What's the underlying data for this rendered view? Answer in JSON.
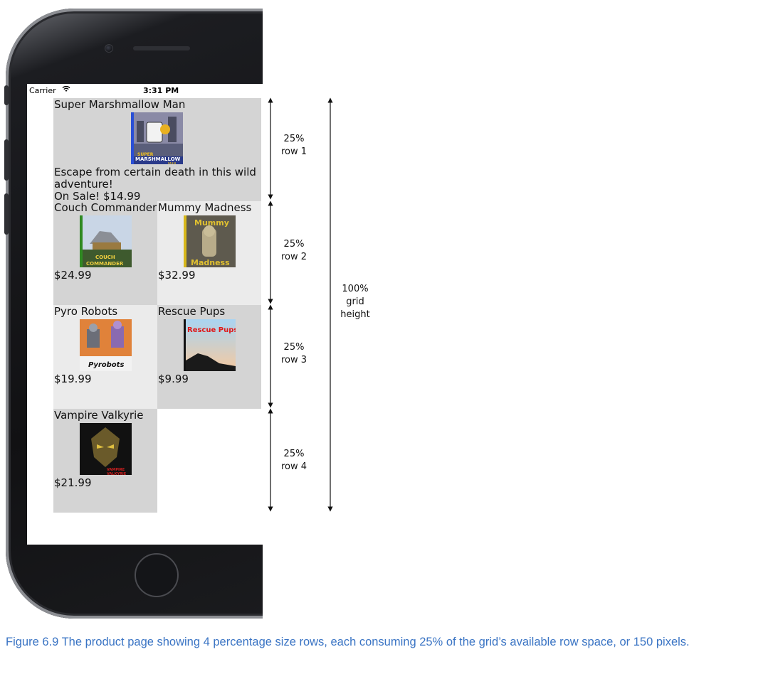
{
  "status_bar": {
    "carrier": "Carrier",
    "time": "3:31 PM"
  },
  "products": [
    {
      "title": "Super Marshmallow Man",
      "description": "Escape from certain death in this wild adventure!",
      "price": "On Sale! $14.99",
      "thumb_text_1": "SUPER",
      "thumb_text_2": "MARSHMALLOW",
      "thumb_text_3": "MAN",
      "accent": "#2a4fd6"
    },
    {
      "title": "Couch Commander",
      "price": "$24.99",
      "thumb_text_1": "COUCH",
      "thumb_text_2": "COMMANDER",
      "accent": "#2f8a22"
    },
    {
      "title": "Mummy Madness",
      "price": "$32.99",
      "thumb_text_1": "Mummy",
      "thumb_text_2": "Madness",
      "accent": "#d8b81a"
    },
    {
      "title": "Pyro Robots",
      "price": "$19.99",
      "thumb_text_1": "Pyrobots"
    },
    {
      "title": "Rescue Pups",
      "price": "$9.99",
      "thumb_text_1": "Rescue Pups"
    },
    {
      "title": "Vampire Valkyrie",
      "price": "$21.99",
      "thumb_text_1": "VAMPIRE",
      "thumb_text_2": "VALKYRIE"
    }
  ],
  "annotations": {
    "row1": {
      "line1": "25%",
      "line2": "row 1"
    },
    "row2": {
      "line1": "25%",
      "line2": "row 2"
    },
    "row3": {
      "line1": "25%",
      "line2": "row 3"
    },
    "row4": {
      "line1": "25%",
      "line2": "row 4"
    },
    "total": {
      "line1": "100%",
      "line2": "grid",
      "line3": "height"
    }
  },
  "caption": "Figure 6.9 The product page showing 4 percentage size rows, each consuming 25% of the grid’s available row space, or 150 pixels.",
  "colors": {
    "cell_dark": "#d4d4d4",
    "cell_light": "#ebebeb",
    "caption": "#3a74c4"
  }
}
